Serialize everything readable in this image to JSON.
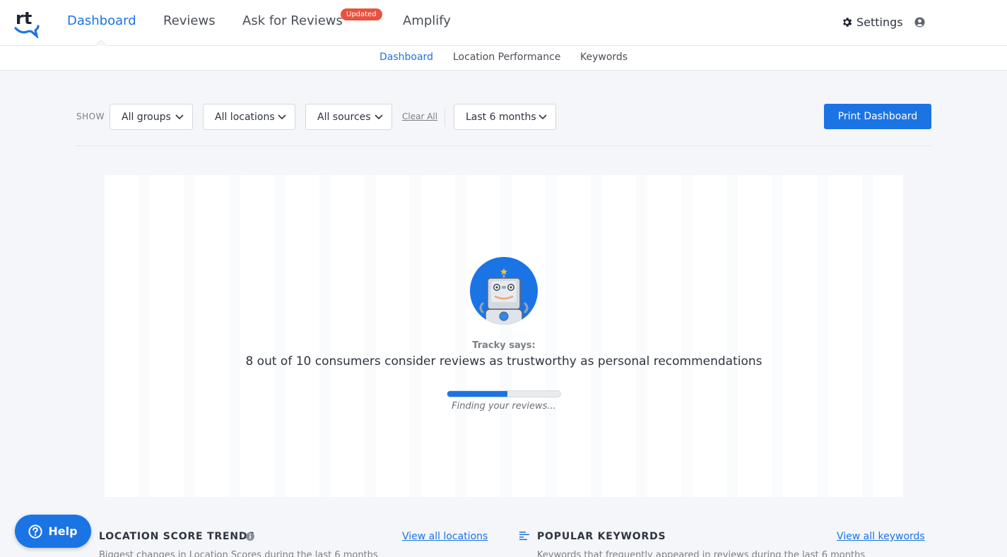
{
  "nav": {
    "items": [
      {
        "label": "Dashboard",
        "active": true
      },
      {
        "label": "Reviews"
      },
      {
        "label": "Ask for Reviews",
        "badge": "Updated"
      },
      {
        "label": "Amplify"
      }
    ],
    "settings_label": "Settings",
    "logo_text": "rt"
  },
  "subnav": {
    "items": [
      {
        "label": "Dashboard",
        "active": true
      },
      {
        "label": "Location Performance"
      },
      {
        "label": "Keywords"
      }
    ]
  },
  "filters": {
    "show_label": "SHOW",
    "groups": "All groups",
    "locations": "All locations",
    "sources": "All sources",
    "clear_all": "Clear All",
    "period": "Last 6 months",
    "print_button": "Print Dashboard"
  },
  "loading": {
    "tracky_label": "Tracky says:",
    "message": "8 out of 10 consumers consider reviews as trustworthy as personal recommendations",
    "progress": 0.53,
    "status": "Finding your reviews..."
  },
  "sections": {
    "trends": {
      "title": "LOCATION SCORE TRENDS",
      "link": "View all locations",
      "subtitle": "Biggest changes in Location Scores during the last 6 months"
    },
    "keywords": {
      "title": "POPULAR KEYWORDS",
      "link": "View all keywords",
      "subtitle": "Keywords that frequently appeared in reviews during the last 6 months"
    }
  },
  "help": {
    "label": "Help"
  },
  "colors": {
    "accent": "#1b74e4",
    "badge": "#e8523f",
    "background": "#f4f6f9"
  }
}
